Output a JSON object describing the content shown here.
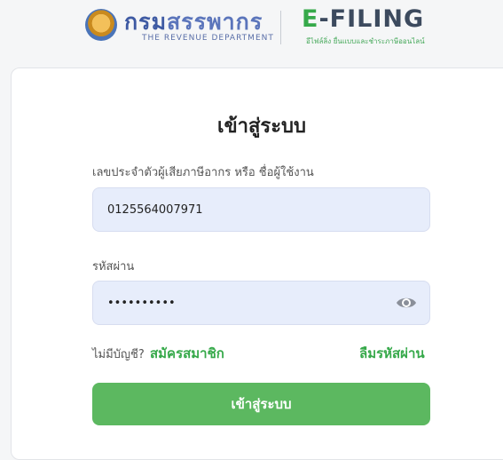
{
  "header": {
    "rd_title_a": "กรม",
    "rd_title_b": "สรรพากร",
    "rd_subtitle": "THE REVENUE DEPARTMENT",
    "efiling_e": "E",
    "efiling_rest": "-FILING",
    "efiling_subtitle": "อีไฟล์ลิ่ง ยื่นแบบและชำระภาษีออนไลน์"
  },
  "login": {
    "title": "เข้าสู่ระบบ",
    "username_label": "เลขประจำตัวผู้เสียภาษีอากร หรือ ชื่อผู้ใช้งาน",
    "username_value": "0125564007971",
    "password_label": "รหัสผ่าน",
    "password_value": "0125564007",
    "no_account_text": "ไม่มีบัญชี?",
    "register_link": "สมัครสมาชิก",
    "forgot_link": "ลืมรหัสผ่าน",
    "submit_label": "เข้าสู่ระบบ"
  },
  "icons": {
    "password_toggle": "eye-icon"
  },
  "colors": {
    "brand_green": "#36a94a",
    "button_green": "#5cb860",
    "brand_blue": "#3e5aa3",
    "field_bg": "#e7edfb"
  }
}
